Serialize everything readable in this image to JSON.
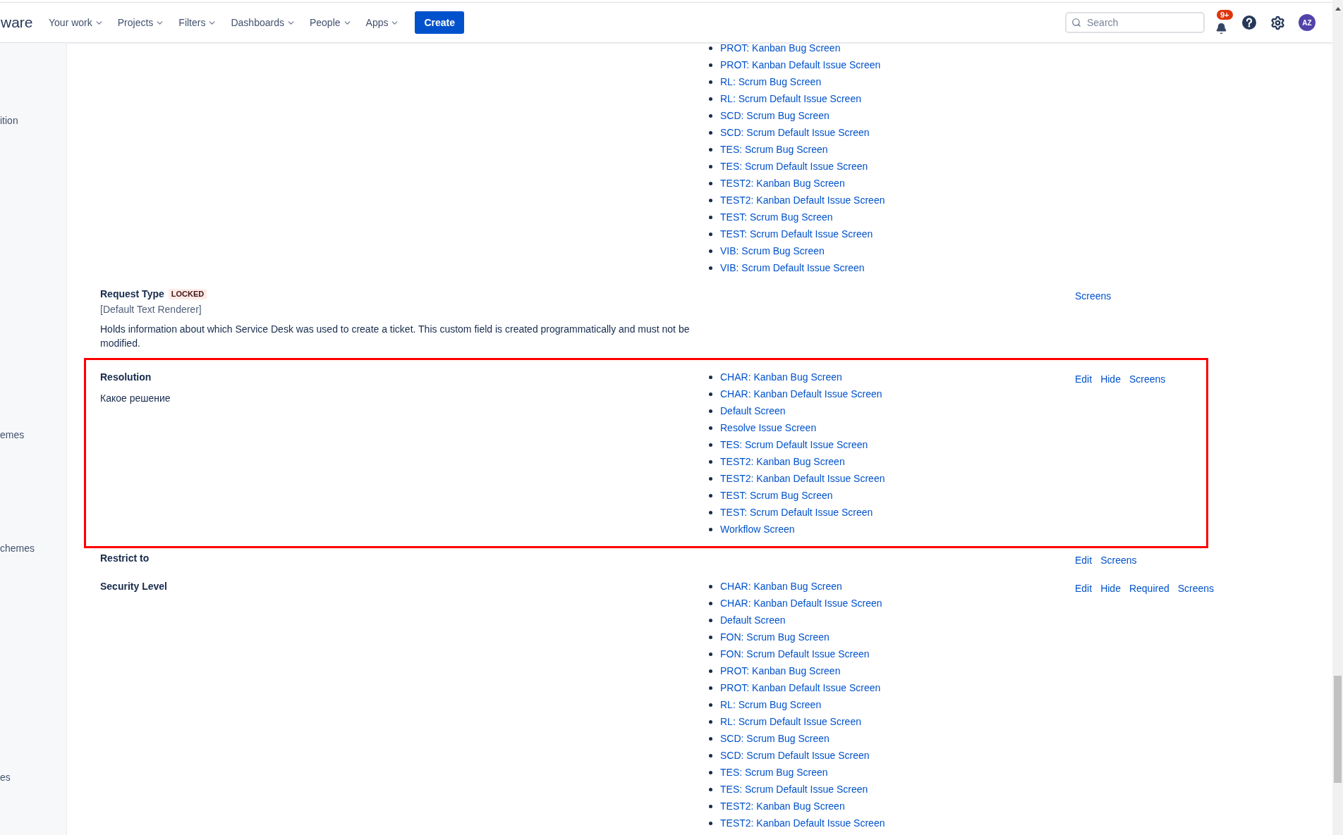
{
  "header": {
    "logo": "ware",
    "nav": [
      "Your work",
      "Projects",
      "Filters",
      "Dashboards",
      "People",
      "Apps"
    ],
    "create_button": "Create",
    "search": {
      "placeholder": "Search"
    },
    "notification_badge": "9+",
    "avatar": "AZ"
  },
  "sidebar": {
    "items": [
      "ition",
      "emes",
      "chemes",
      "es"
    ]
  },
  "fields": [
    {
      "highlighted": false,
      "screens": [
        "PROT: Kanban Bug Screen",
        "PROT: Kanban Default Issue Screen",
        "RL: Scrum Bug Screen",
        "RL: Scrum Default Issue Screen",
        "SCD: Scrum Bug Screen",
        "SCD: Scrum Default Issue Screen",
        "TES: Scrum Bug Screen",
        "TES: Scrum Default Issue Screen",
        "TEST2: Kanban Bug Screen",
        "TEST2: Kanban Default Issue Screen",
        "TEST: Scrum Bug Screen",
        "TEST: Scrum Default Issue Screen",
        "VIB: Scrum Bug Screen",
        "VIB: Scrum Default Issue Screen"
      ]
    },
    {
      "title": "Request Type",
      "badge": "LOCKED",
      "renderer": "[Default Text Renderer]",
      "description": "Holds information about which Service Desk was used to create a ticket. This custom field is created programmatically and must not be modified.",
      "highlighted": false,
      "actions": [
        "Screens"
      ]
    },
    {
      "title": "Resolution",
      "description": "Какое решение",
      "highlighted": true,
      "screens": [
        "CHAR: Kanban Bug Screen",
        "CHAR: Kanban Default Issue Screen",
        "Default Screen",
        "Resolve Issue Screen",
        "TES: Scrum Default Issue Screen",
        "TEST2: Kanban Bug Screen",
        "TEST2: Kanban Default Issue Screen",
        "TEST: Scrum Bug Screen",
        "TEST: Scrum Default Issue Screen",
        "Workflow Screen"
      ],
      "actions": [
        "Edit",
        "Hide",
        "Screens"
      ]
    },
    {
      "title": "Restrict to",
      "highlighted": false,
      "actions": [
        "Edit",
        "Screens"
      ]
    },
    {
      "title": "Security Level",
      "highlighted": false,
      "screens": [
        "CHAR: Kanban Bug Screen",
        "CHAR: Kanban Default Issue Screen",
        "Default Screen",
        "FON: Scrum Bug Screen",
        "FON: Scrum Default Issue Screen",
        "PROT: Kanban Bug Screen",
        "PROT: Kanban Default Issue Screen",
        "RL: Scrum Bug Screen",
        "RL: Scrum Default Issue Screen",
        "SCD: Scrum Bug Screen",
        "SCD: Scrum Default Issue Screen",
        "TES: Scrum Bug Screen",
        "TES: Scrum Default Issue Screen",
        "TEST2: Kanban Bug Screen",
        "TEST2: Kanban Default Issue Screen"
      ],
      "actions": [
        "Edit",
        "Hide",
        "Required",
        "Screens"
      ]
    }
  ]
}
